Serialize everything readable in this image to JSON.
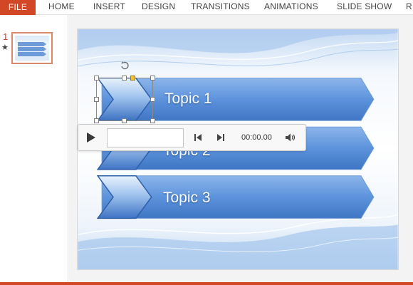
{
  "ribbon": {
    "tabs": [
      {
        "label": "FILE"
      },
      {
        "label": "HOME"
      },
      {
        "label": "INSERT"
      },
      {
        "label": "DESIGN"
      },
      {
        "label": "TRANSITIONS"
      },
      {
        "label": "ANIMATIONS"
      },
      {
        "label": "SLIDE SHOW"
      },
      {
        "label": "R"
      }
    ]
  },
  "thumbnails": {
    "slide_number": "1",
    "animation_marker": "★"
  },
  "slide": {
    "topics": [
      "Topic 1",
      "Topic 2",
      "Topic 3"
    ]
  },
  "media": {
    "time": "00:00.00"
  },
  "colors": {
    "accent": "#d24726",
    "arrow_blue": "#4f86d0",
    "slide_bg_blue": "#bcd6f1"
  }
}
